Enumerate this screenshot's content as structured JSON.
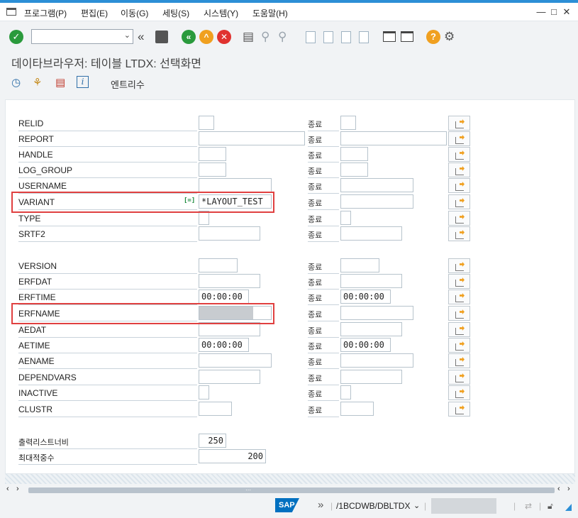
{
  "menu": {
    "items": [
      "프로그램(P)",
      "편집(E)",
      "이동(G)",
      "세팅(S)",
      "시스템(Y)",
      "도움말(H)"
    ]
  },
  "window": {
    "minimize": "—",
    "maximize": "□",
    "close": "✕"
  },
  "toolbar": {
    "command_value": "",
    "icons": [
      "enter-check",
      "command-field",
      "save",
      "back",
      "exit",
      "cancel",
      "print",
      "find",
      "find-next",
      "first-page",
      "previous-page",
      "next-page",
      "last-page",
      "new-session",
      "shortcut",
      "help",
      "customize"
    ]
  },
  "title": "데이타브라우저: 테이블 LTDX: 선택화면",
  "app_toolbar": {
    "label": "엔트리수"
  },
  "to_label": "종료",
  "fields_group1": [
    {
      "label": "RELID",
      "value": "",
      "to_value": ""
    },
    {
      "label": "REPORT",
      "value": "",
      "to_value": ""
    },
    {
      "label": "HANDLE",
      "value": "",
      "to_value": ""
    },
    {
      "label": "LOG_GROUP",
      "value": "",
      "to_value": ""
    },
    {
      "label": "USERNAME",
      "value": "",
      "to_value": ""
    },
    {
      "label": "VARIANT",
      "value": "*LAYOUT_TEST",
      "to_value": ""
    },
    {
      "label": "TYPE",
      "value": "",
      "to_value": ""
    },
    {
      "label": "SRTF2",
      "value": "",
      "to_value": ""
    }
  ],
  "fields_group2": [
    {
      "label": "VERSION",
      "value": "",
      "to_value": ""
    },
    {
      "label": "ERFDAT",
      "value": "",
      "to_value": ""
    },
    {
      "label": "ERFTIME",
      "value": "00:00:00",
      "to_value": "00:00:00"
    },
    {
      "label": "ERFNAME",
      "value": "",
      "to_value": ""
    },
    {
      "label": "AEDAT",
      "value": "",
      "to_value": ""
    },
    {
      "label": "AETIME",
      "value": "00:00:00",
      "to_value": "00:00:00"
    },
    {
      "label": "AENAME",
      "value": "",
      "to_value": ""
    },
    {
      "label": "DEPENDVARS",
      "value": "",
      "to_value": ""
    },
    {
      "label": "INACTIVE",
      "value": "",
      "to_value": ""
    },
    {
      "label": "CLUSTR",
      "value": "",
      "to_value": ""
    }
  ],
  "output": [
    {
      "label": "출력리스트너비",
      "value": "250"
    },
    {
      "label": "최대적중수",
      "value": "200"
    }
  ],
  "variant_option": "[=]",
  "status": {
    "sap_logo": "SAP",
    "transaction": "/1BCDWB/DBLTDX",
    "grip": "⋯"
  },
  "colors": {
    "accent": "#2c8fd6",
    "highlight": "#e04040",
    "ok_green": "#2a9a3c",
    "help_orange": "#f0a020"
  }
}
